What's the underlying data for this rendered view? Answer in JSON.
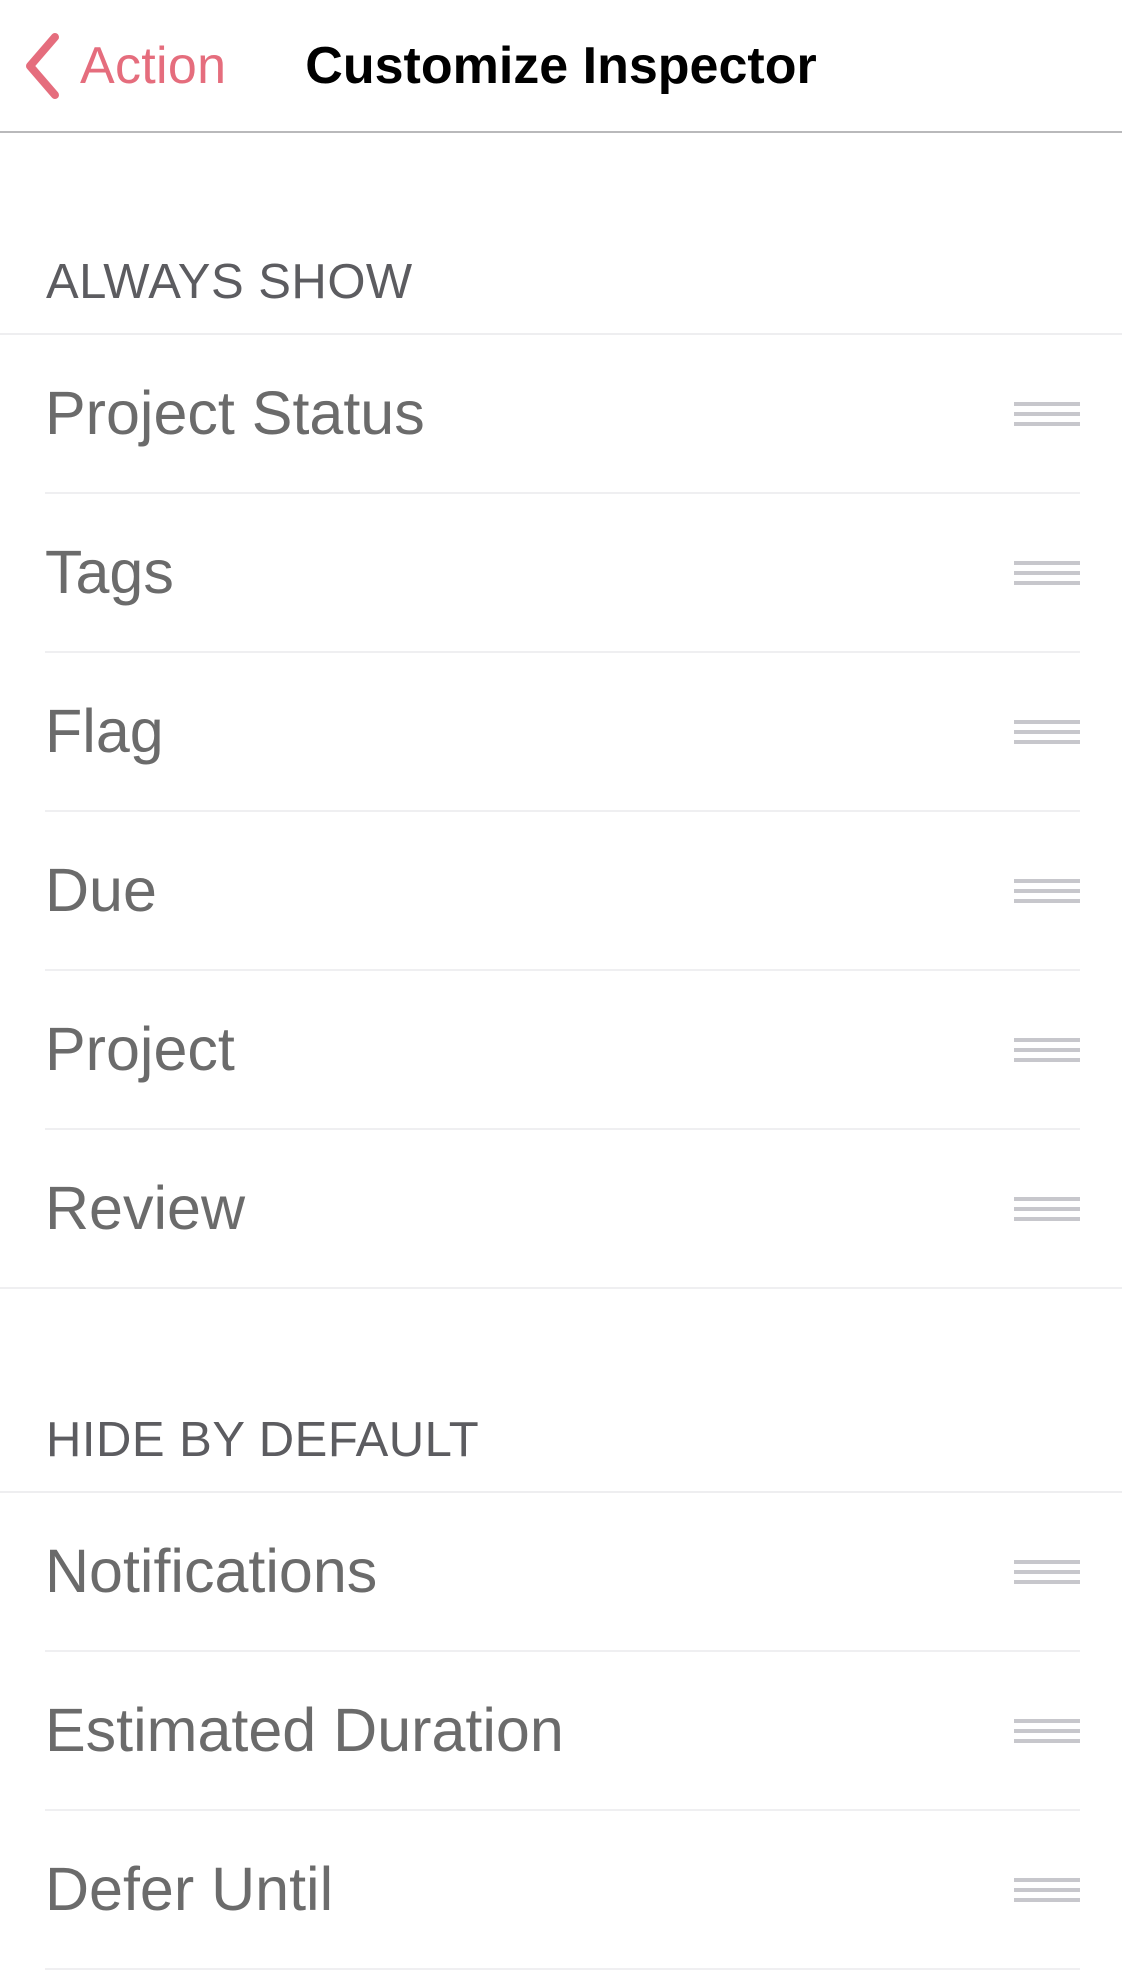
{
  "nav": {
    "back_label": "Action",
    "back_icon": "chevron-left-icon",
    "title": "Customize Inspector",
    "accent_color": "#e56d7d"
  },
  "sections": [
    {
      "header": "ALWAYS SHOW",
      "items": [
        {
          "label": "Project Status",
          "handle_icon": "reorder-handle-icon"
        },
        {
          "label": "Tags",
          "handle_icon": "reorder-handle-icon"
        },
        {
          "label": "Flag",
          "handle_icon": "reorder-handle-icon"
        },
        {
          "label": "Due",
          "handle_icon": "reorder-handle-icon"
        },
        {
          "label": "Project",
          "handle_icon": "reorder-handle-icon"
        },
        {
          "label": "Review",
          "handle_icon": "reorder-handle-icon"
        }
      ]
    },
    {
      "header": "HIDE BY DEFAULT",
      "items": [
        {
          "label": "Notifications",
          "handle_icon": "reorder-handle-icon"
        },
        {
          "label": "Estimated Duration",
          "handle_icon": "reorder-handle-icon"
        },
        {
          "label": "Defer Until",
          "handle_icon": "reorder-handle-icon"
        }
      ]
    }
  ]
}
